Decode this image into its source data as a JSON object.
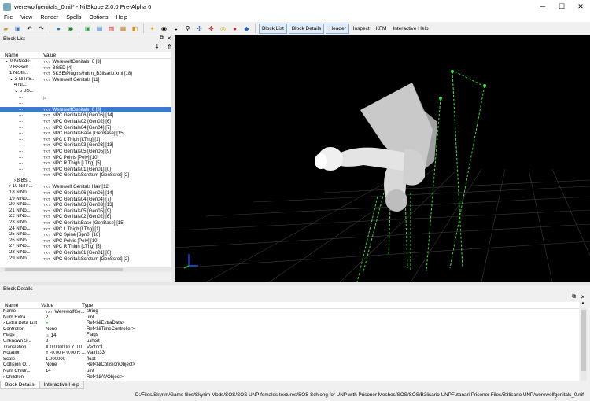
{
  "window": {
    "title": "werewolfgenitals_0.nif* - NifSkope 2.0.0 Pre-Alpha 6"
  },
  "menu": [
    "File",
    "View",
    "Render",
    "Spells",
    "Options",
    "Help"
  ],
  "toolbar": {
    "tabs": [
      "Block List",
      "Block Details",
      "Header",
      "Inspect",
      "KFM",
      "Interactive Help"
    ],
    "active": [
      "Block List",
      "Block Details",
      "Header"
    ]
  },
  "block_list": {
    "title": "Block List",
    "columns": [
      "Name",
      "Value"
    ],
    "rows": [
      {
        "name": "0 NiNode",
        "value": "WerewolfGenitals_0 [3]",
        "tag": "TXT",
        "indent": 0,
        "arrow": "v"
      },
      {
        "name": "2 BSBeh...",
        "value": "BGED [4]",
        "tag": "TXT",
        "indent": 1,
        "arrow": ""
      },
      {
        "name": "1 NiStri...",
        "value": "SKSE\\Plugins\\hdtm_B3lisario.xml [18]",
        "tag": "TXT",
        "indent": 1,
        "arrow": ""
      },
      {
        "name": "3 NiTriS...",
        "value": "Werewolf Genitals [11]",
        "tag": "TXT",
        "indent": 1,
        "arrow": "v"
      },
      {
        "name": "4 Ni...",
        "value": "",
        "tag": "",
        "indent": 2,
        "arrow": ""
      },
      {
        "name": "5 BS...",
        "value": "",
        "tag": "",
        "indent": 2,
        "arrow": "v"
      },
      {
        "name": "...",
        "value": "",
        "tag": "|≡",
        "indent": 3,
        "arrow": ""
      },
      {
        "name": "...",
        "value": "",
        "tag": "",
        "indent": 3,
        "arrow": ""
      },
      {
        "name": "...",
        "value": "WerewolfGenitals_0 [3]",
        "tag": "TXT",
        "indent": 3,
        "arrow": "",
        "selected": true
      },
      {
        "name": "...",
        "value": "NPC Genitals06 [Gen06] [14]",
        "tag": "TXT",
        "indent": 3,
        "arrow": ""
      },
      {
        "name": "...",
        "value": "NPC Genitals02 [Gen02] [6]",
        "tag": "TXT",
        "indent": 3,
        "arrow": ""
      },
      {
        "name": "...",
        "value": "NPC Genitals04 [Gen04] [7]",
        "tag": "TXT",
        "indent": 3,
        "arrow": ""
      },
      {
        "name": "...",
        "value": "NPC GenitalsBase [GenBase] [15]",
        "tag": "TXT",
        "indent": 3,
        "arrow": ""
      },
      {
        "name": "...",
        "value": "NPC L Thigh [LThg] [1]",
        "tag": "TXT",
        "indent": 3,
        "arrow": ""
      },
      {
        "name": "...",
        "value": "NPC Genitals03 [Gen03] [13]",
        "tag": "TXT",
        "indent": 3,
        "arrow": ""
      },
      {
        "name": "...",
        "value": "NPC Genitals05 [Gen05] [9]",
        "tag": "TXT",
        "indent": 3,
        "arrow": ""
      },
      {
        "name": "...",
        "value": "NPC Pelvis [Pelv] [10]",
        "tag": "TXT",
        "indent": 3,
        "arrow": ""
      },
      {
        "name": "...",
        "value": "NPC R Thigh [LThg] [5]",
        "tag": "TXT",
        "indent": 3,
        "arrow": ""
      },
      {
        "name": "...",
        "value": "NPC Genitals01 [Gen01] [0]",
        "tag": "TXT",
        "indent": 3,
        "arrow": ""
      },
      {
        "name": "...",
        "value": "NPC GenitalsScrotum [GenScrot] [2]",
        "tag": "TXT",
        "indent": 3,
        "arrow": ""
      },
      {
        "name": "8 BS...",
        "value": "",
        "tag": "",
        "indent": 2,
        "arrow": ">"
      },
      {
        "name": "10 NiTri...",
        "value": "Werewolf Genitals Hair [12]",
        "tag": "TXT",
        "indent": 1,
        "arrow": ">"
      },
      {
        "name": "18 NiNo...",
        "value": "NPC Genitals06 [Gen06] [14]",
        "tag": "TXT",
        "indent": 1,
        "arrow": ""
      },
      {
        "name": "19 NiNo...",
        "value": "NPC Genitals04 [Gen04] [7]",
        "tag": "TXT",
        "indent": 1,
        "arrow": ""
      },
      {
        "name": "20 NiNo...",
        "value": "NPC Genitals03 [Gen03] [13]",
        "tag": "TXT",
        "indent": 1,
        "arrow": ""
      },
      {
        "name": "21 NiNo...",
        "value": "NPC Genitals05 [Gen05] [9]",
        "tag": "TXT",
        "indent": 1,
        "arrow": ""
      },
      {
        "name": "22 NiNo...",
        "value": "NPC Genitals02 [Gen02] [6]",
        "tag": "TXT",
        "indent": 1,
        "arrow": ""
      },
      {
        "name": "23 NiNo...",
        "value": "NPC GenitalsBase [GenBase] [15]",
        "tag": "TXT",
        "indent": 1,
        "arrow": ""
      },
      {
        "name": "24 NiNo...",
        "value": "NPC L Thigh [LThg] [1]",
        "tag": "TXT",
        "indent": 1,
        "arrow": ""
      },
      {
        "name": "25 NiNo...",
        "value": "NPC Spine [Spn0] [16]",
        "tag": "TXT",
        "indent": 1,
        "arrow": ""
      },
      {
        "name": "26 NiNo...",
        "value": "NPC Pelvis [Pelv] [10]",
        "tag": "TXT",
        "indent": 1,
        "arrow": ""
      },
      {
        "name": "27 NiNo...",
        "value": "NPC R Thigh [LThg] [5]",
        "tag": "TXT",
        "indent": 1,
        "arrow": ""
      },
      {
        "name": "28 NiNo...",
        "value": "NPC Genitals01 [Gen01] [0]",
        "tag": "TXT",
        "indent": 1,
        "arrow": ""
      },
      {
        "name": "29 NiNo...",
        "value": "NPC GenitalsScrotum [GenScrot] [2]",
        "tag": "TXT",
        "indent": 1,
        "arrow": ""
      }
    ]
  },
  "block_details": {
    "title": "Block Details",
    "columns": [
      "Name",
      "Value",
      "Type"
    ],
    "rows": [
      {
        "name": "Name",
        "value": "WerewolfGe...",
        "type": "string",
        "tag": "TXT",
        "arrow": ""
      },
      {
        "name": "Num Extra ...",
        "value": "2",
        "type": "uint",
        "tag": "",
        "arrow": ""
      },
      {
        "name": "Extra Data List",
        "value": "",
        "type": "Ref<NiExtraData>",
        "tag": "",
        "arrow": ">",
        "green": true
      },
      {
        "name": "Controller",
        "value": "None",
        "type": "Ref<NiTimeController>",
        "tag": "",
        "arrow": ""
      },
      {
        "name": "Flags",
        "value": "14",
        "type": "Flags",
        "tag": "|≡",
        "arrow": ""
      },
      {
        "name": "Unknown S...",
        "value": "8",
        "type": "ushort",
        "tag": "",
        "arrow": ""
      },
      {
        "name": "Translation",
        "value": "X 0.000000 Y 0.0...",
        "type": "Vector3",
        "tag": "",
        "arrow": ""
      },
      {
        "name": "Rotation",
        "value": "Y -0.00 P 0.00 R ...",
        "type": "Matrix33",
        "tag": "",
        "arrow": ""
      },
      {
        "name": "Scale",
        "value": "1.000000",
        "type": "float",
        "tag": "",
        "arrow": ""
      },
      {
        "name": "Collision O...",
        "value": "None",
        "type": "Ref<NiCollisionObject>",
        "tag": "",
        "arrow": ""
      },
      {
        "name": "Num Childr...",
        "value": "14",
        "type": "uint",
        "tag": "",
        "arrow": ""
      },
      {
        "name": "Children",
        "value": "",
        "type": "Ref<NiAVObject>",
        "tag": "",
        "arrow": ">"
      }
    ]
  },
  "bottom_tabs": [
    "Block Details",
    "Interactive Help"
  ],
  "status": "D:/Files/Skyrim/Game files/Skyrim Mods/SOS/SOS UNP females textures/SOS Schlong for UNP with Prisoner Meshes/SOS/SOS/B3lisario UNPFutanari Prisoner Files/B3lisario UNP/werewolfgenitals_0.nif",
  "colors": {
    "selection": "#3a7ad0",
    "bone_marker": "#3fdc3f",
    "viewport_bg": "#000000"
  },
  "icons": [
    "folder-icon",
    "save-icon",
    "undo-icon",
    "redo-icon",
    "render-icon",
    "palette-icon",
    "camera-icon",
    "light-icon",
    "skeleton-icon",
    "axes-icon",
    "pin-icon",
    "help-icon"
  ]
}
